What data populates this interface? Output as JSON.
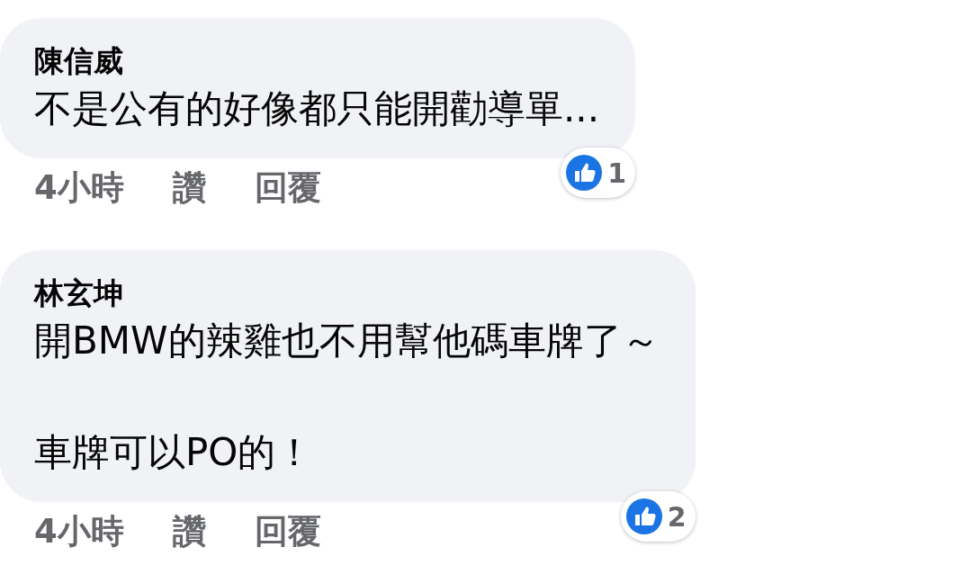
{
  "comments": [
    {
      "author": "陳信威",
      "paragraphs": [
        "不是公有的好像都只能開勸導單..."
      ],
      "reaction_count": "1",
      "time": "4小時",
      "like": "讚",
      "reply": "回覆"
    },
    {
      "author": "林玄坤",
      "paragraphs": [
        "開BMW的辣雞也不用幫他碼車牌了～",
        "車牌可以PO的！"
      ],
      "reaction_count": "2",
      "time": "4小時",
      "like": "讚",
      "reply": "回覆"
    }
  ]
}
